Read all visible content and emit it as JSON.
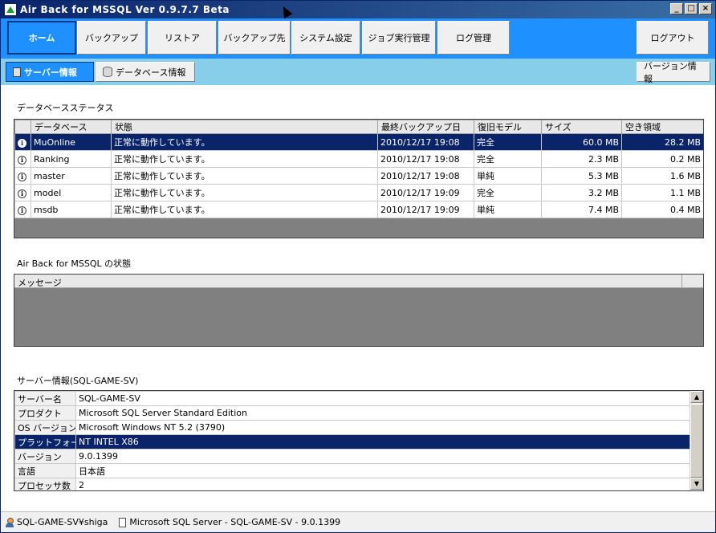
{
  "window": {
    "title": "Air Back for MSSQL Ver 0.9.7.7 Beta",
    "min": "_",
    "max": "□",
    "close": "×"
  },
  "toolbar": {
    "home": "ホーム",
    "backup": "バックアップ",
    "restore": "リストア",
    "destination": "バックアップ先",
    "system": "システム設定",
    "jobs": "ジョブ実行管理",
    "logs": "ログ管理",
    "logout": "ログアウト"
  },
  "subtabs": {
    "server_info": "サーバー情報",
    "db_info": "データベース情報",
    "version_info": "バージョン情報"
  },
  "db_section": {
    "title": "データベースステータス",
    "columns": [
      "データベース",
      "状態",
      "最終バックアップ日",
      "復旧モデル",
      "サイズ",
      "空き領域"
    ],
    "rows": [
      {
        "name": "MuOnline",
        "status": "正常に動作しています。",
        "last_backup": "2010/12/17 19:08",
        "model": "完全",
        "size": "60.0 MB",
        "free": "28.2 MB"
      },
      {
        "name": "Ranking",
        "status": "正常に動作しています。",
        "last_backup": "2010/12/17 19:08",
        "model": "完全",
        "size": "2.3 MB",
        "free": "0.2 MB"
      },
      {
        "name": "master",
        "status": "正常に動作しています。",
        "last_backup": "2010/12/17 19:08",
        "model": "単純",
        "size": "5.3 MB",
        "free": "1.6 MB"
      },
      {
        "name": "model",
        "status": "正常に動作しています。",
        "last_backup": "2010/12/17 19:09",
        "model": "完全",
        "size": "3.2 MB",
        "free": "1.1 MB"
      },
      {
        "name": "msdb",
        "status": "正常に動作しています。",
        "last_backup": "2010/12/17 19:09",
        "model": "単純",
        "size": "7.4 MB",
        "free": "0.4 MB"
      }
    ],
    "selected_row": 0
  },
  "status_section": {
    "title": "Air Back for MSSQL の状態",
    "column": "メッセージ"
  },
  "server_section": {
    "title": "サーバー情報(SQL-GAME-SV)",
    "rows": [
      {
        "key": "サーバー名",
        "value": "SQL-GAME-SV"
      },
      {
        "key": "プロダクト",
        "value": "Microsoft SQL Server Standard Edition"
      },
      {
        "key": "OS バージョン",
        "value": "Microsoft Windows NT 5.2 (3790)"
      },
      {
        "key": "プラットフォーム",
        "value": "NT INTEL X86"
      },
      {
        "key": "バージョン",
        "value": "9.0.1399"
      },
      {
        "key": "言語",
        "value": "日本語"
      },
      {
        "key": "プロセッサ数",
        "value": "2"
      }
    ],
    "selected_row": 3
  },
  "statusbar": {
    "user": "SQL-GAME-SV¥shiga",
    "server": "Microsoft SQL Server - SQL-GAME-SV - 9.0.1399"
  }
}
